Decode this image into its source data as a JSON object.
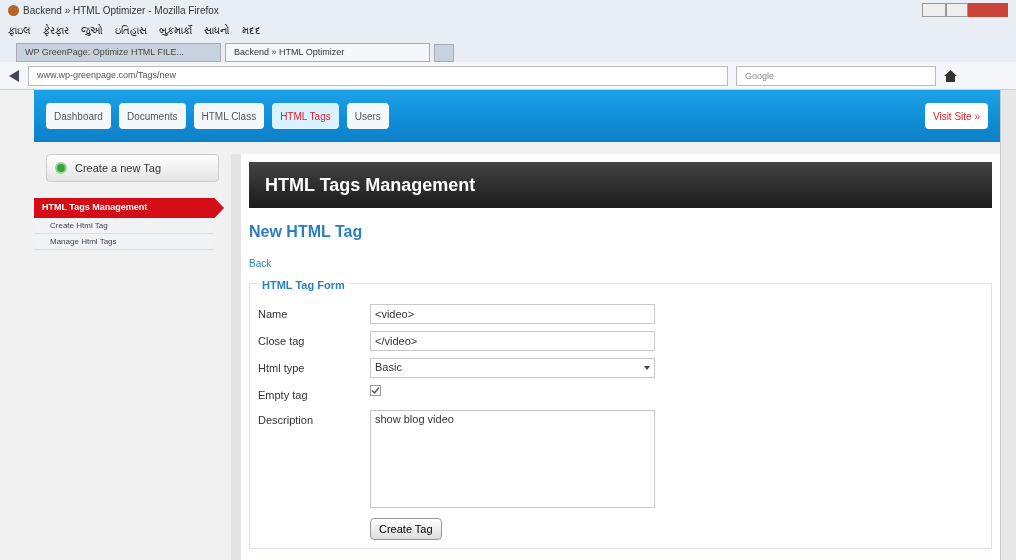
{
  "window": {
    "title": "Backend » HTML Optimizer - Mozilla Firefox"
  },
  "menu": [
    "ફાઇલ",
    "ફેરફાર",
    "જુઓ",
    "ઇતિહાસ",
    "બુકમાર્કો",
    "સાધનો",
    "મદદ"
  ],
  "browser_tabs": [
    {
      "label": "WP GreenPage: Optimize HTML FILE...",
      "selected": false
    },
    {
      "label": "Backend » HTML Optimizer",
      "selected": true
    }
  ],
  "address": "www.wp-greenpage.com/Tags/new",
  "search": {
    "placeholder": "Google"
  },
  "nav": [
    {
      "label": "Dashboard",
      "selected": false
    },
    {
      "label": "Documents",
      "selected": false
    },
    {
      "label": "HTML Class",
      "selected": false
    },
    {
      "label": "HTML Tags",
      "selected": true
    },
    {
      "label": "Users",
      "selected": false
    }
  ],
  "visit_site": "Visit Site »",
  "sidebar": {
    "create_button": "Create a new Tag",
    "items": [
      {
        "label": "HTML Tags Management",
        "selected": true,
        "children": [
          {
            "label": "Create Html Tag",
            "selected": false
          },
          {
            "label": "Manage Html Tags",
            "selected": false
          }
        ]
      }
    ]
  },
  "page_header": "HTML Tags Management",
  "heading": "New HTML Tag",
  "back": "Back",
  "form": {
    "legend": "HTML Tag Form",
    "fields": [
      {
        "kind": "text",
        "label": "Name",
        "value": "<video>"
      },
      {
        "kind": "text",
        "label": "Close tag",
        "value": "</video>"
      },
      {
        "kind": "select",
        "label": "Html type",
        "value": "Basic"
      },
      {
        "kind": "checkbox",
        "label": "Empty tag",
        "checked": true
      },
      {
        "kind": "textarea",
        "label": "Description",
        "value": "show blog video"
      }
    ],
    "submit": "Create Tag"
  }
}
